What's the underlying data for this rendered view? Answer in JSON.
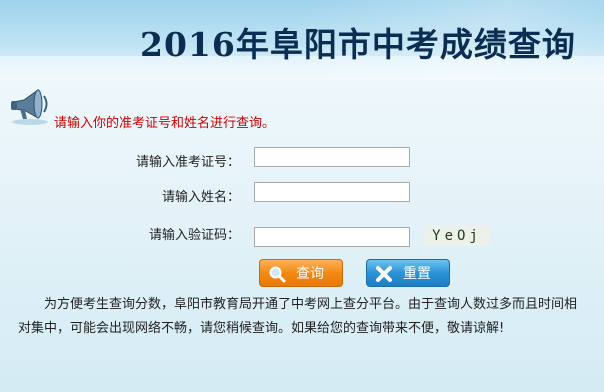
{
  "header": {
    "title": "2016年阜阳市中考成绩查询"
  },
  "notice": {
    "text": "请输入你的准考证号和姓名进行查询。"
  },
  "form": {
    "exam_number_label": "请输入准考证号：",
    "exam_number_value": "",
    "name_label": "请输入姓名：",
    "name_value": "",
    "captcha_label": "请输入验证码：",
    "captcha_value": "",
    "captcha_text": "YeOj"
  },
  "buttons": {
    "query_label": "查询",
    "reset_label": "重置"
  },
  "description": {
    "text": "为方便考生查询分数，阜阳市教育局开通了中考网上查分平台。由于查询人数过多而且时间相对集中，可能会出现网络不畅，请您稍候查询。如果给您的查询带来不便，敬请谅解!"
  },
  "colors": {
    "notice": "#cc0000",
    "title": "#0b2d52",
    "query_button": "#f28a12",
    "reset_button": "#2a93d6"
  },
  "icons": {
    "speaker": "megaphone-icon",
    "query": "magnifier-icon",
    "reset": "x-icon"
  }
}
